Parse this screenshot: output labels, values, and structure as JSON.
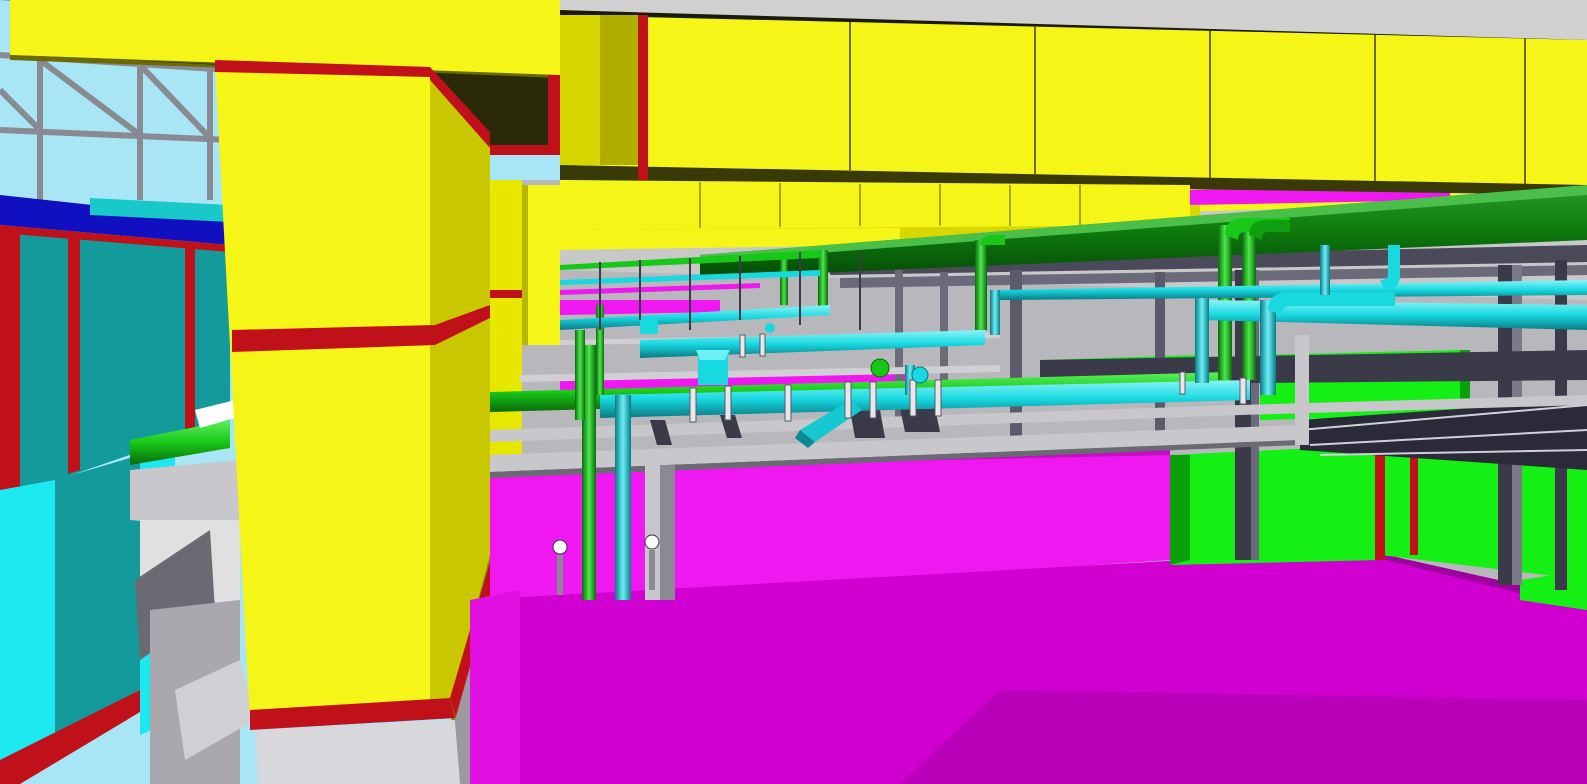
{
  "scene": {
    "kind": "3D BIM / MEP model render",
    "palette": {
      "sky": "#a9e6f5",
      "duct_yellow": "#f6f518",
      "duct_yellow_shade": "#c9c800",
      "duct_yellow_dark": "#8c8a00",
      "flange_red": "#c0101a",
      "magenta_top": "#d800d8",
      "magenta_light": "#f018f0",
      "magenta_dark": "#a000a0",
      "green_duct": "#14f014",
      "green_duct_dark": "#0aa00a",
      "green_pipe": "#18c818",
      "green_pipe_dark": "#0a7a0a",
      "cyan_pipe": "#18d8e0",
      "cyan_pipe_dark": "#0a8a94",
      "teal_duct": "#139a9a",
      "teal_duct_light": "#19c9c9",
      "blue_duct": "#1010c0",
      "steel_light": "#c8c8cc",
      "steel_mid": "#8a8a92",
      "steel_dark": "#3a3a48",
      "ceiling_dark": "#1a1a08"
    }
  }
}
